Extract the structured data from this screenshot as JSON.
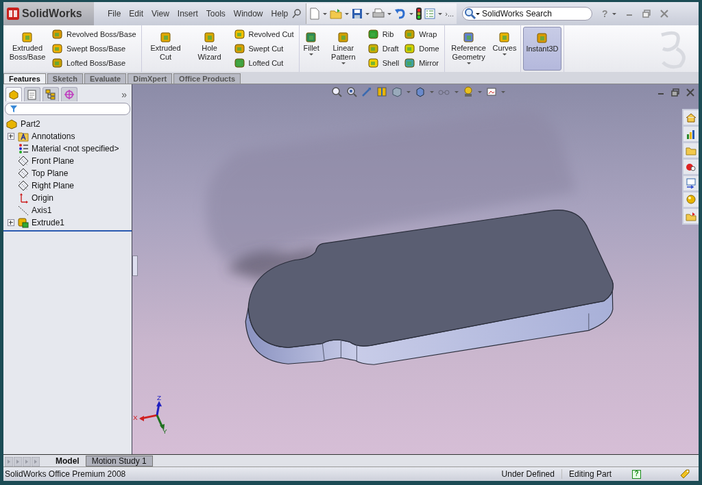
{
  "app": {
    "logo": "SolidWorks"
  },
  "menu": [
    "File",
    "Edit",
    "View",
    "Insert",
    "Tools",
    "Window",
    "Help"
  ],
  "toolbar": {
    "overflow": "›..."
  },
  "search": {
    "placeholder": "SolidWorks Search"
  },
  "help": "?",
  "ribbon": [
    {
      "items": [
        {
          "kind": "large",
          "label": "Extruded Boss/Base",
          "dropdown": false
        },
        {
          "kind": "stack",
          "labels": [
            "Revolved Boss/Base",
            "Swept Boss/Base",
            "Lofted Boss/Base"
          ]
        }
      ]
    },
    {
      "items": [
        {
          "kind": "large",
          "label": "Extruded Cut",
          "dropdown": false
        },
        {
          "kind": "large",
          "label": "Hole Wizard",
          "dropdown": false
        },
        {
          "kind": "stack",
          "labels": [
            "Revolved Cut",
            "Swept Cut",
            "Lofted Cut"
          ]
        }
      ]
    },
    {
      "items": [
        {
          "kind": "large",
          "label": "Fillet",
          "dropdown": true
        },
        {
          "kind": "large",
          "label": "Linear Pattern",
          "dropdown": true
        },
        {
          "kind": "stack",
          "labels": [
            "Rib",
            "Draft",
            "Shell"
          ]
        },
        {
          "kind": "stack",
          "labels": [
            "Wrap",
            "Dome",
            "Mirror"
          ]
        }
      ]
    },
    {
      "items": [
        {
          "kind": "large",
          "label": "Reference Geometry",
          "dropdown": true
        },
        {
          "kind": "large",
          "label": "Curves",
          "dropdown": true
        }
      ]
    },
    {
      "items": [
        {
          "kind": "large",
          "label": "Instant3D",
          "dropdown": false,
          "selected": true
        }
      ]
    }
  ],
  "command_tabs": [
    {
      "label": "Features",
      "selected": true
    },
    {
      "label": "Sketch",
      "selected": false
    },
    {
      "label": "Evaluate",
      "selected": false
    },
    {
      "label": "DimXpert",
      "selected": false
    },
    {
      "label": "Office Products",
      "selected": false
    }
  ],
  "panel": {
    "tabs": [
      {
        "selected": true
      },
      {
        "selected": false
      },
      {
        "selected": false
      },
      {
        "selected": false
      }
    ],
    "more": "»"
  },
  "tree": {
    "label": "Part2",
    "children": [
      {
        "kind": "annotation",
        "label": "Annotations",
        "expanded": false
      },
      {
        "kind": "material",
        "label": "Material <not specified>"
      },
      {
        "kind": "plane",
        "label": "Front Plane"
      },
      {
        "kind": "plane",
        "label": "Top Plane"
      },
      {
        "kind": "plane",
        "label": "Right Plane"
      },
      {
        "kind": "origin",
        "label": "Origin"
      },
      {
        "kind": "axis",
        "label": "Axis1"
      },
      {
        "kind": "feature",
        "label": "Extrude1",
        "expanded": false
      }
    ]
  },
  "triad": {
    "x": "X",
    "y": "Y",
    "z": "Z"
  },
  "bottom_tabs": [
    {
      "label": "Model",
      "selected": true
    },
    {
      "label": "Motion Study 1",
      "selected": false
    }
  ],
  "status_bar": {
    "product": "SolidWorks Office Premium 2008",
    "state": "Under Defined",
    "mode": "Editing Part",
    "help_mark": "?"
  }
}
